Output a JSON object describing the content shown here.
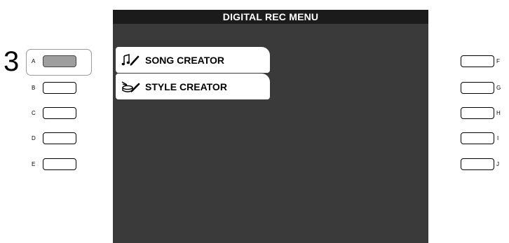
{
  "step_number": "3",
  "screen": {
    "title": "DIGITAL REC MENU",
    "menu_items": [
      {
        "label": "SONG CREATOR",
        "icon": "song-note-pencil-icon",
        "button": "A"
      },
      {
        "label": "STYLE CREATOR",
        "icon": "style-drum-pencil-icon",
        "button": "B"
      }
    ]
  },
  "left_buttons": [
    {
      "letter": "A",
      "pressed": true
    },
    {
      "letter": "B",
      "pressed": false
    },
    {
      "letter": "C",
      "pressed": false
    },
    {
      "letter": "D",
      "pressed": false
    },
    {
      "letter": "E",
      "pressed": false
    }
  ],
  "right_buttons": [
    {
      "letter": "F"
    },
    {
      "letter": "G"
    },
    {
      "letter": "H"
    },
    {
      "letter": "I"
    },
    {
      "letter": "J"
    }
  ],
  "colors": {
    "screen_bg": "#3a3a3a",
    "title_bar_bg": "#1b1b1b",
    "pressed_button": "#9e9e9e"
  }
}
